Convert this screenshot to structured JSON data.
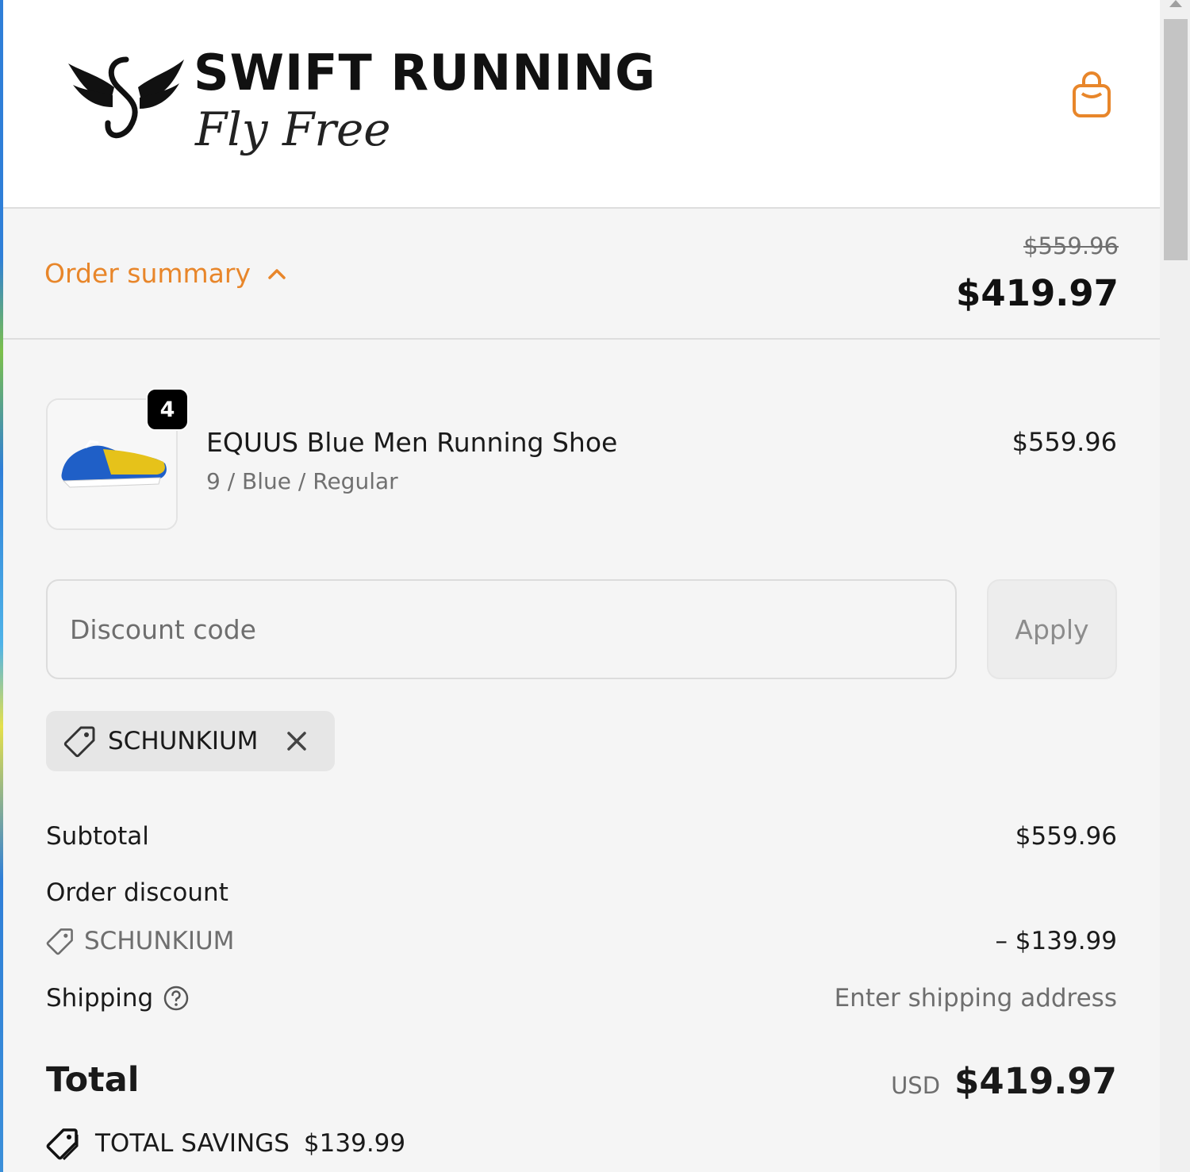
{
  "header": {
    "brand_name": "SWIFT RUNNING",
    "tagline": "Fly Free",
    "cart_icon": "shopping-bag-icon",
    "accent_color": "#e8862a"
  },
  "summary": {
    "toggle_label": "Order summary",
    "toggle_icon": "chevron-up-icon",
    "compare_at_price": "$559.96",
    "total": "$419.97"
  },
  "line_items": [
    {
      "quantity": "4",
      "name": "EQUUS Blue Men Running Shoe",
      "variant": "9 / Blue / Regular",
      "price": "$559.96"
    }
  ],
  "discount": {
    "placeholder": "Discount code",
    "value": "",
    "apply_label": "Apply",
    "applied_code": "SCHUNKIUM"
  },
  "totals": {
    "subtotal_label": "Subtotal",
    "subtotal_value": "$559.96",
    "order_discount_label": "Order discount",
    "discount_code": "SCHUNKIUM",
    "discount_value": "– $139.99",
    "shipping_label": "Shipping",
    "shipping_value": "Enter shipping address",
    "total_label": "Total",
    "currency": "USD",
    "total_value": "$419.97",
    "savings_label": "TOTAL SAVINGS",
    "savings_value": "$139.99"
  }
}
